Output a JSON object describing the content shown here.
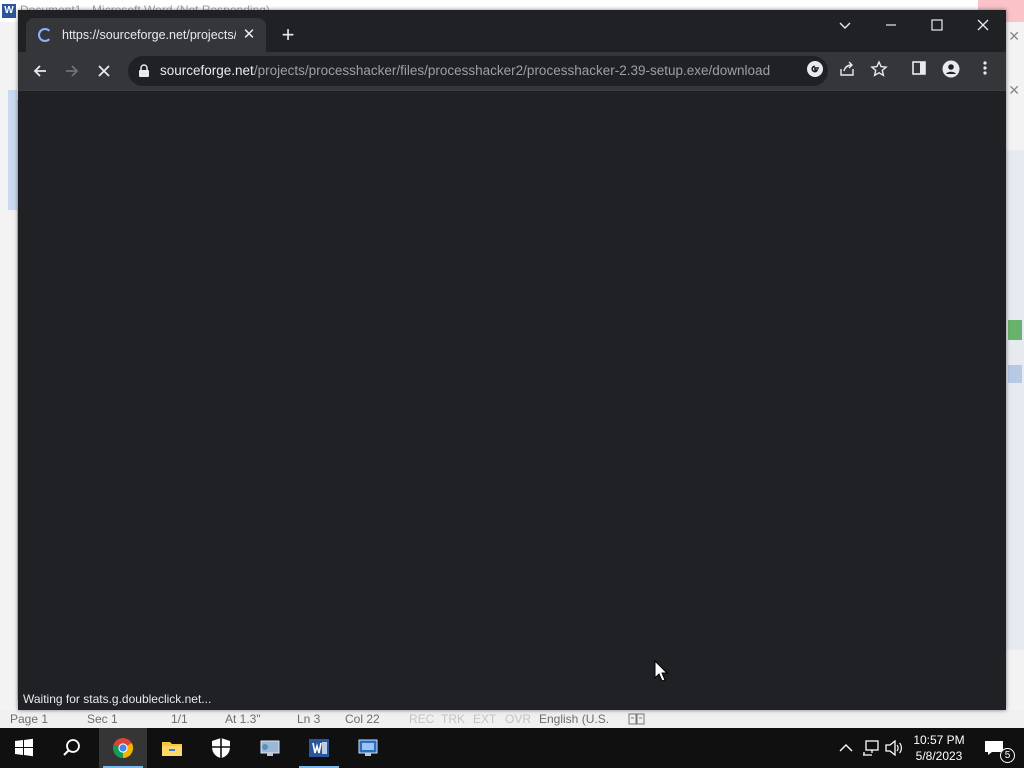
{
  "word": {
    "title_fragment": "Document1 - Microsoft Word (Not Responding)",
    "status": {
      "page": "Page 1",
      "sec": "Sec 1",
      "pages": "1/1",
      "at": "At 1.3\"",
      "ln": "Ln 3",
      "col": "Col 22",
      "rec": "REC",
      "trk": "TRK",
      "ext": "EXT",
      "ovr": "OVR",
      "lang": "English (U.S."
    }
  },
  "browser": {
    "tab_title": "https://sourceforge.net/projects/",
    "url_host": "sourceforge.net",
    "url_path": "/projects/processhacker/files/processhacker2/processhacker-2.39-setup.exe/download",
    "status_text": "Waiting for stats.g.doubleclick.net..."
  },
  "taskbar": {
    "time": "10:57 PM",
    "date": "5/8/2023",
    "notification_count": "5"
  },
  "colors": {
    "chrome_frame": "#202124",
    "chrome_toolbar": "#35363a",
    "spinner_accent": "#8ab4f8",
    "taskbar": "#101010"
  }
}
